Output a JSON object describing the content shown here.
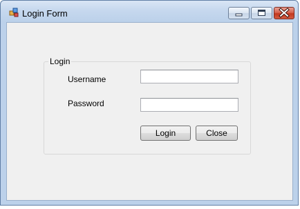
{
  "window": {
    "title": "Login Form",
    "app_icon": "form-app-icon",
    "caption_buttons": [
      "minimize-icon",
      "maximize-icon",
      "close-icon"
    ]
  },
  "login_group": {
    "legend": "Login",
    "username_label": "Username",
    "username_value": "",
    "password_label": "Password",
    "password_value": "",
    "login_button": "Login",
    "close_button": "Close"
  },
  "colors": {
    "titlebar": "#c6d8ee",
    "client_bg": "#f0f0f0",
    "close_button": "#c2381f"
  }
}
